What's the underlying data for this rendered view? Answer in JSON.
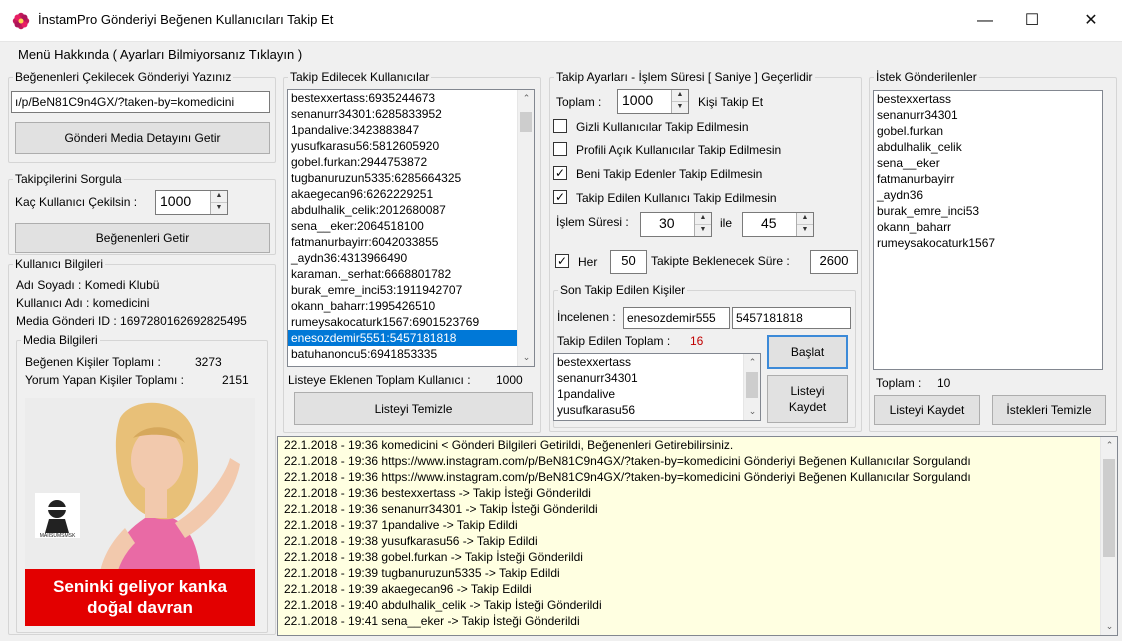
{
  "window": {
    "title": "İnstamPro Gönderiyi Beğenen Kullanıcıları Takip Et",
    "minimize": "—",
    "maximize": "☐",
    "close": "✕"
  },
  "menu": {
    "about": "Menü Hakkında ( Ayarları Bilmiyorsanız Tıklayın )"
  },
  "post_input": {
    "legend": "Beğenenleri Çekilecek Gönderiyi Yazınız",
    "value": "ı/p/BeN81C9n4GX/?taken-by=komedicini",
    "button": "Gönderi Media Detayını Getir"
  },
  "query_followers": {
    "legend": "Takipçilerini Sorgula",
    "count_label": "Kaç Kullanıcı Çekilsin :",
    "count_value": "1000",
    "button": "Beğenenleri Getir"
  },
  "user_info": {
    "legend": "Kullanıcı Bilgileri",
    "name": "Adı Soyadı : Komedi Klubü",
    "username": "Kullanıcı Adı : komedicini",
    "media_id": "Media Gönderi ID : 1697280162692825495"
  },
  "media_info": {
    "legend": "Media Bilgileri",
    "likes_label": "Beğenen Kişiler Toplamı :",
    "likes_value": "3273",
    "comments_label": "Yorum Yapan Kişiler Toplamı :",
    "comments_value": "2151",
    "image_caption_line1": "Seninki geliyor kanka",
    "image_caption_line2": "doğal davran",
    "image_logo": "MAIISUMSMSK"
  },
  "follow_list": {
    "legend": "Takip Edilecek Kullanıcılar",
    "items": [
      "bestexxertass:6935244673",
      "senanurr34301:6285833952",
      "1pandalive:3423883847",
      "yusufkarasu56:5812605920",
      "gobel.furkan:2944753872",
      "tugbanuruzun5335:6285664325",
      "akaegecan96:6262229251",
      "abdulhalik_celik:2012680087",
      "sena__eker:2064518100",
      "fatmanurbayirr:6042033855",
      "_aydn36:4313966490",
      "karaman._serhat:6668801782",
      "burak_emre_inci53:1911942707",
      "okann_baharr:1995426510",
      "rumeysakocaturk1567:6901523769",
      "enesozdemir5551:5457181818",
      "batuhanoncu5:6941853335"
    ],
    "selected_index": 15,
    "total_label": "Listeye Eklenen Toplam Kullanıcı :",
    "total_value": "1000",
    "clear_button": "Listeyi Temizle"
  },
  "settings": {
    "legend": "Takip Ayarları - İşlem Süresi [ Saniye ] Geçerlidir",
    "total_label": "Toplam :",
    "total_value": "1000",
    "total_suffix": "Kişi Takip Et",
    "options": [
      {
        "label": "Gizli Kullanıcılar Takip Edilmesin",
        "checked": false
      },
      {
        "label": "Profili Açık Kullanıcılar Takip Edilmesin",
        "checked": false
      },
      {
        "label": "Beni Takip Edenler Takip Edilmesin",
        "checked": true
      },
      {
        "label": "Takip Edilen Kullanıcı Takip Edilmesin",
        "checked": true
      }
    ],
    "duration_label": "İşlem Süresi :",
    "duration_min": "30",
    "duration_and": "ile",
    "duration_max": "45",
    "every_label": "Her",
    "every_checked": true,
    "every_value": "50",
    "wait_label": "Takipte Beklenecek Süre :",
    "wait_value": "2600"
  },
  "last_followed": {
    "legend": "Son Takip Edilen Kişiler",
    "inspected_label": "İncelenen :",
    "inspected_user": "enesozdemir555",
    "inspected_id": "5457181818",
    "total_label": "Takip Edilen Toplam :",
    "total_value": "16",
    "items": [
      "bestexxertass",
      "senanurr34301",
      "1pandalive",
      "yusufkarasu56"
    ],
    "start_button": "Başlat",
    "save_button_line1": "Listeyi",
    "save_button_line2": "Kaydet"
  },
  "requests": {
    "legend": "İstek Gönderilenler",
    "items": [
      "bestexxertass",
      "senanurr34301",
      "gobel.furkan",
      "abdulhalik_celik",
      "sena__eker",
      "fatmanurbayirr",
      "_aydn36",
      "burak_emre_inci53",
      "okann_baharr",
      "rumeysakocaturk1567"
    ],
    "total_label": "Toplam :",
    "total_value": "10",
    "save_button": "Listeyi Kaydet",
    "clear_button": "İstekleri Temizle"
  },
  "log": {
    "lines": [
      "22.1.2018 - 19:36   komedicini < Gönderi Bilgileri Getirildi, Beğenenleri Getirebilirsiniz.",
      "22.1.2018 - 19:36   https://www.instagram.com/p/BeN81C9n4GX/?taken-by=komedicini Gönderiyi Beğenen Kullanıcılar Sorgulandı",
      "22.1.2018 - 19:36   https://www.instagram.com/p/BeN81C9n4GX/?taken-by=komedicini Gönderiyi Beğenen Kullanıcılar Sorgulandı",
      "22.1.2018 - 19:36   bestexxertass -> Takip İsteği Gönderildi",
      "22.1.2018 - 19:36   senanurr34301 -> Takip İsteği Gönderildi",
      "22.1.2018 - 19:37   1pandalive -> Takip Edildi",
      "22.1.2018 - 19:38   yusufkarasu56 -> Takip Edildi",
      "22.1.2018 - 19:38   gobel.furkan -> Takip İsteği Gönderildi",
      "22.1.2018 - 19:39   tugbanuruzun5335 -> Takip Edildi",
      "22.1.2018 - 19:39   akaegecan96 -> Takip Edildi",
      "22.1.2018 - 19:40   abdulhalik_celik -> Takip İsteği Gönderildi",
      "22.1.2018 - 19:41   sena__eker -> Takip İsteği Gönderildi"
    ]
  },
  "colors": {
    "accent": "#0078d7",
    "log_bg": "#ffffe1",
    "banner": "#e30000",
    "count_red": "#c00000",
    "app_icon": "#c2185b"
  },
  "icons": {
    "app": "app-flower-icon",
    "checkmark": "✓",
    "spin_up": "▲",
    "spin_down": "▼",
    "scroll_up": "⌃",
    "scroll_down": "⌄"
  }
}
